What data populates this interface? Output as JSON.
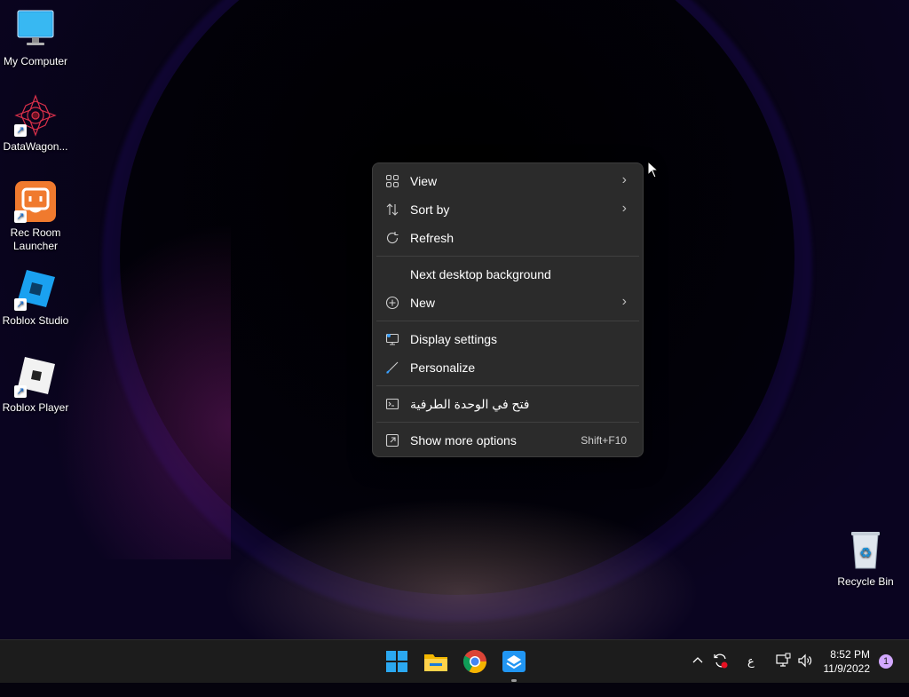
{
  "desktop": {
    "icons": [
      {
        "label": "My Computer"
      },
      {
        "label": "DataWagon..."
      },
      {
        "label": "Rec Room Launcher"
      },
      {
        "label": "Roblox Studio"
      },
      {
        "label": "Roblox Player"
      },
      {
        "label": "Recycle Bin"
      }
    ]
  },
  "context_menu": {
    "items": [
      {
        "label": "View",
        "icon": "grid-icon",
        "submenu": true
      },
      {
        "label": "Sort by",
        "icon": "sort-icon",
        "submenu": true
      },
      {
        "label": "Refresh",
        "icon": "refresh-icon"
      },
      {
        "label": "Next desktop background"
      },
      {
        "label": "New",
        "icon": "plus-circle-icon",
        "submenu": true
      },
      {
        "label": "Display settings",
        "icon": "display-icon"
      },
      {
        "label": "Personalize",
        "icon": "brush-icon"
      },
      {
        "label": "فتح في الوحدة الطرفية",
        "icon": "terminal-icon"
      },
      {
        "label": "Show more options",
        "icon": "expand-icon",
        "shortcut": "Shift+F10"
      }
    ]
  },
  "taskbar": {
    "apps": [
      "start-icon",
      "file-explorer-icon",
      "chrome-icon",
      "app-icon"
    ],
    "tray": {
      "language": "ع",
      "time": "8:52 PM",
      "date": "11/9/2022",
      "notifications": "1"
    }
  },
  "colors": {
    "menu_bg": "#2b2b2b",
    "taskbar_bg": "#1c1c1c",
    "accent": "#0078d4"
  }
}
